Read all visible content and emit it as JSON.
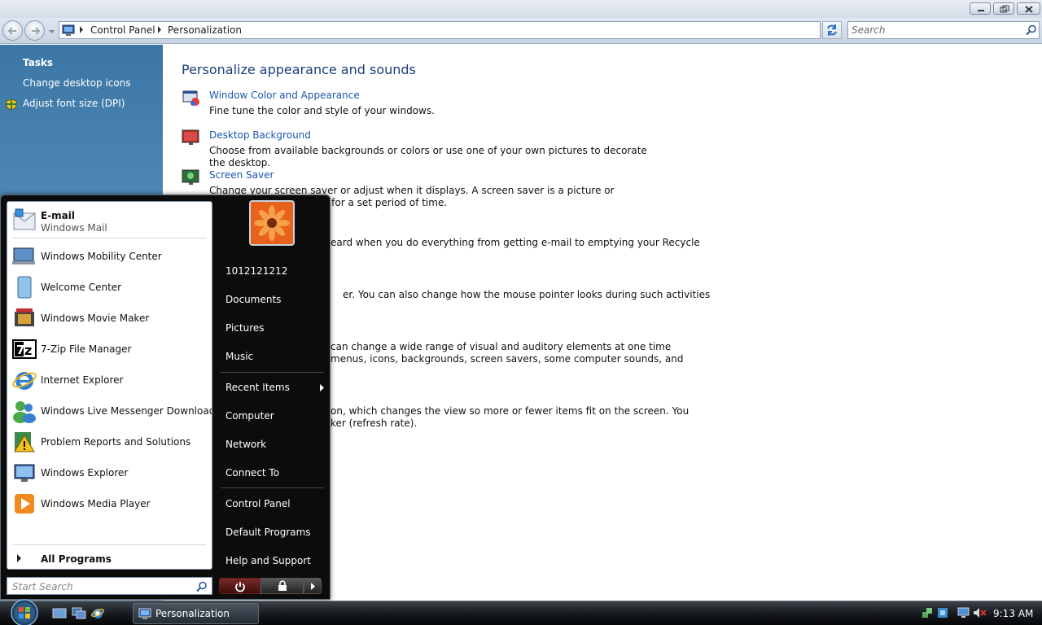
{
  "window": {
    "breadcrumbs": [
      "Control Panel",
      "Personalization"
    ],
    "search_placeholder": "Search"
  },
  "sidebar": {
    "heading": "Tasks",
    "links": [
      "Change desktop icons",
      "Adjust font size (DPI)"
    ]
  },
  "content": {
    "title": "Personalize appearance and sounds",
    "items": [
      {
        "link": "Window Color and Appearance",
        "desc": "Fine tune the color and style of your windows."
      },
      {
        "link": "Desktop Background",
        "desc": "Choose from available backgrounds or colors or use one of your own pictures to decorate the desktop."
      },
      {
        "link": "Screen Saver",
        "desc_line1": "Change your screen saver or adjust when it displays. A screen saver is a picture or animation that covers",
        "desc_line2": "en your computer is idle for a set period of time."
      }
    ],
    "partial_lines": [
      "eard when you do everything from getting e-mail to emptying your Recycle",
      "er. You can also change how the mouse pointer looks during such activities",
      "can change a wide range of visual and auditory elements at one time",
      "menus, icons, backgrounds, screen savers, some computer sounds, and",
      "on, which changes the view so more or fewer items fit on the screen. You",
      "ker (refresh rate)."
    ]
  },
  "start_menu": {
    "pinned": {
      "title": "E-mail",
      "subtitle": "Windows Mail"
    },
    "programs": [
      "Windows Mobility Center",
      "Welcome Center",
      "Windows Movie Maker",
      "7-Zip File Manager",
      "Internet Explorer",
      "Windows Live Messenger Download",
      "Problem Reports and Solutions",
      "Windows Explorer",
      "Windows Media Player"
    ],
    "all_programs": "All Programs",
    "search_placeholder": "Start Search",
    "right": {
      "user": "1012121212",
      "documents": "Documents",
      "pictures": "Pictures",
      "music": "Music",
      "recent": "Recent Items",
      "computer": "Computer",
      "network": "Network",
      "connect": "Connect To",
      "control_panel": "Control Panel",
      "default_programs": "Default Programs",
      "help": "Help and Support"
    }
  },
  "taskbar": {
    "task_label": "Personalization",
    "clock": "9:13 AM"
  },
  "colors": {
    "link": "#1a56b0",
    "title": "#1c3e7a",
    "sidebar": "#4f89b8",
    "taskbar": "#1b1f23"
  }
}
